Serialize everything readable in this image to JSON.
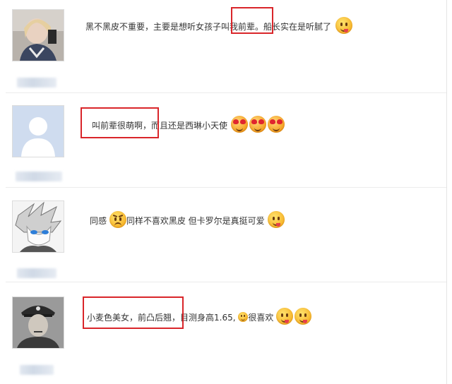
{
  "comments": [
    {
      "text_pre": "黑不黑皮不重要，主要是想听女孩子叫",
      "text_hl": "我前辈。",
      "text_post": "船长实在是听腻了",
      "emojis": [
        "grin-tongue-icon"
      ]
    },
    {
      "text_hl": "叫前辈很萌啊，",
      "text_post": "而且还是西琳小天使",
      "emojis": [
        "heart-eyes-icon",
        "heart-eyes-icon",
        "heart-eyes-icon"
      ]
    },
    {
      "text_pre": "同感",
      "text_post": "同样不喜欢黑皮 但卡罗尔是真挺可爱",
      "emojis": [
        "angry-face-icon",
        "grin-tongue-icon"
      ]
    },
    {
      "text_hl": "小麦色美女，前凸后翘，",
      "text_post": "目测身高1.65,",
      "text_tail": "很喜欢",
      "emojis": [
        "small-face-icon",
        "grin-tongue-icon",
        "grin-tongue-icon"
      ]
    }
  ],
  "colors": {
    "highlight": "#d9252a",
    "separator": "#ececec",
    "text": "#333333"
  }
}
